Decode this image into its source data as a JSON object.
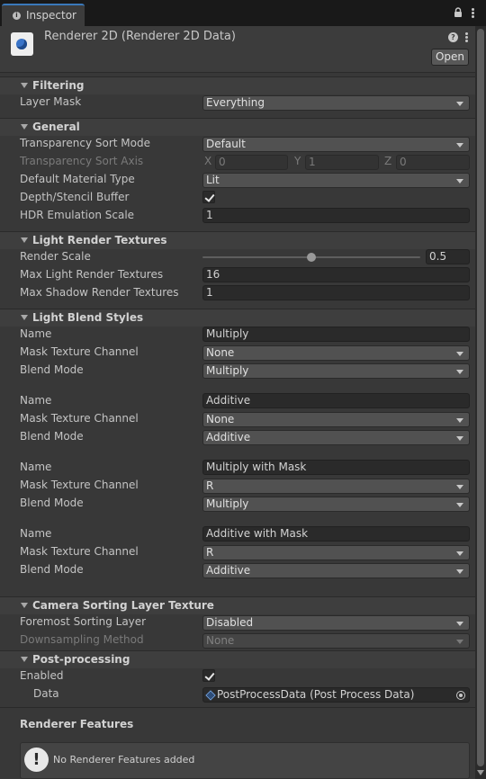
{
  "window": {
    "tab_label": "Inspector"
  },
  "header": {
    "title": "Renderer 2D (Renderer 2D Data)",
    "open_label": "Open"
  },
  "filtering": {
    "title": "Filtering",
    "layer_mask_label": "Layer Mask",
    "layer_mask_value": "Everything"
  },
  "general": {
    "title": "General",
    "sort_mode_label": "Transparency Sort Mode",
    "sort_mode_value": "Default",
    "sort_axis_label": "Transparency Sort Axis",
    "axis_x_label": "X",
    "axis_x_value": "0",
    "axis_y_label": "Y",
    "axis_y_value": "1",
    "axis_z_label": "Z",
    "axis_z_value": "0",
    "material_label": "Default Material Type",
    "material_value": "Lit",
    "depth_label": "Depth/Stencil Buffer",
    "depth_checked": true,
    "hdr_label": "HDR Emulation Scale",
    "hdr_value": "1"
  },
  "light_render_textures": {
    "title": "Light Render Textures",
    "render_scale_label": "Render Scale",
    "render_scale_value": "0.5",
    "render_scale_fraction": 0.5,
    "max_light_label": "Max Light Render Textures",
    "max_light_value": "16",
    "max_shadow_label": "Max Shadow Render Textures",
    "max_shadow_value": "1"
  },
  "light_blend_styles": {
    "title": "Light Blend Styles",
    "name_label": "Name",
    "channel_label": "Mask Texture Channel",
    "blend_label": "Blend Mode",
    "styles": [
      {
        "name": "Multiply",
        "channel": "None",
        "blend": "Multiply"
      },
      {
        "name": "Additive",
        "channel": "None",
        "blend": "Additive"
      },
      {
        "name": "Multiply with Mask",
        "channel": "R",
        "blend": "Multiply"
      },
      {
        "name": "Additive with Mask",
        "channel": "R",
        "blend": "Additive"
      }
    ]
  },
  "camera_sorting": {
    "title": "Camera Sorting Layer Texture",
    "foremost_label": "Foremost Sorting Layer",
    "foremost_value": "Disabled",
    "downsampling_label": "Downsampling Method",
    "downsampling_value": "None"
  },
  "post_processing": {
    "title": "Post-processing",
    "enabled_label": "Enabled",
    "enabled_checked": true,
    "data_label": "Data",
    "data_value": "PostProcessData (Post Process Data)"
  },
  "renderer_features": {
    "title": "Renderer Features",
    "empty_message": "No Renderer Features added"
  }
}
